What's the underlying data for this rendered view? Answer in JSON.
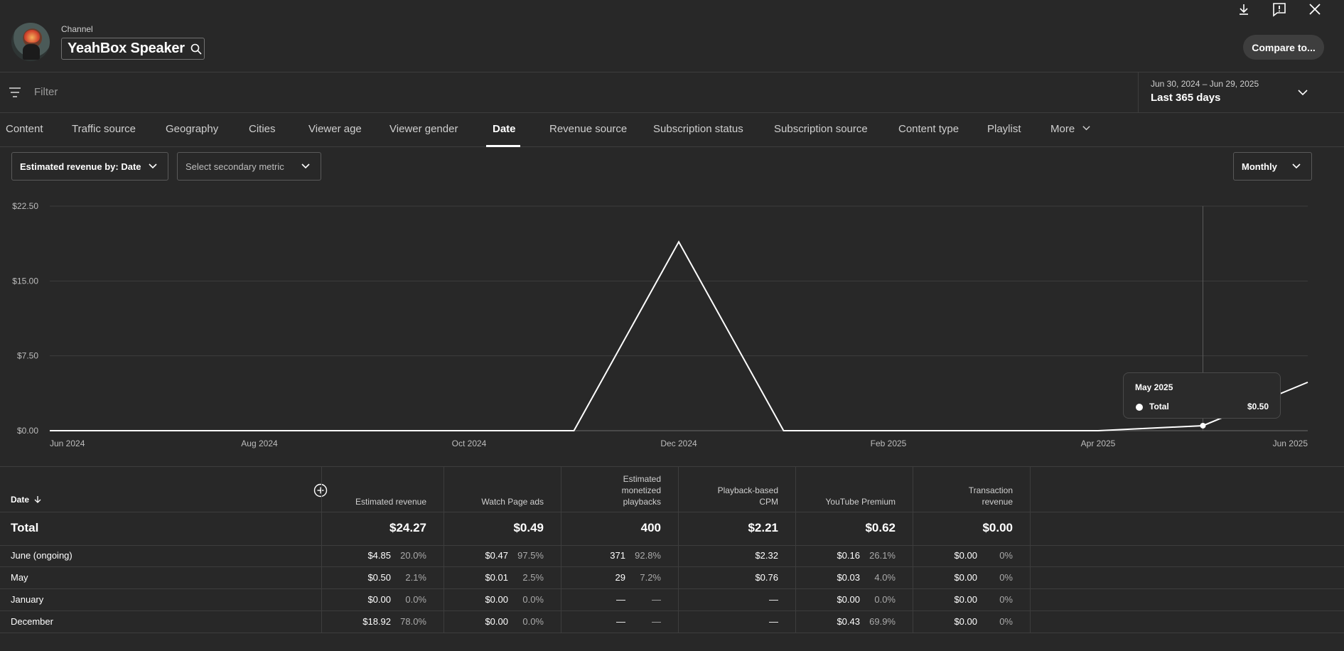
{
  "header": {
    "channel_label": "Channel",
    "channel_name": "YeahBox Speaker",
    "compare_label": "Compare to..."
  },
  "filterbar": {
    "placeholder": "Filter",
    "date_range_sub": "Jun 30, 2024 – Jun 29, 2025",
    "date_range_main": "Last 365 days"
  },
  "tabs": [
    {
      "label": "Content"
    },
    {
      "label": "Traffic source"
    },
    {
      "label": "Geography"
    },
    {
      "label": "Cities"
    },
    {
      "label": "Viewer age"
    },
    {
      "label": "Viewer gender"
    },
    {
      "label": "Date",
      "active": true
    },
    {
      "label": "Revenue source"
    },
    {
      "label": "Subscription status"
    },
    {
      "label": "Subscription source"
    },
    {
      "label": "Content type"
    },
    {
      "label": "Playlist"
    },
    {
      "label": "More"
    }
  ],
  "controls": {
    "primary_metric": "Estimated revenue by: Date",
    "secondary_metric": "Select secondary metric",
    "interval": "Monthly"
  },
  "chart_data": {
    "type": "line",
    "x_tick_labels": [
      "Jun 2024",
      "Aug 2024",
      "Oct 2024",
      "Dec 2024",
      "Feb 2025",
      "Apr 2025",
      "Jun 2025"
    ],
    "y_tick_labels": [
      "$22.50",
      "$15.00",
      "$7.50",
      "$0.00"
    ],
    "ylim": [
      0,
      22.5
    ],
    "series": [
      {
        "name": "Total",
        "x": [
          "2024-06",
          "2024-07",
          "2024-08",
          "2024-09",
          "2024-10",
          "2024-11",
          "2024-12",
          "2025-01",
          "2025-02",
          "2025-03",
          "2025-04",
          "2025-05",
          "2025-06"
        ],
        "values": [
          0,
          0,
          0,
          0,
          0,
          0,
          18.92,
          0,
          0,
          0,
          0,
          0.5,
          4.85
        ]
      }
    ],
    "hover": {
      "title": "May 2025",
      "series": "Total",
      "value": "$0.50"
    }
  },
  "table": {
    "date_header": "Date",
    "columns": [
      {
        "lines": [
          "Estimated revenue"
        ]
      },
      {
        "lines": [
          "Watch Page ads"
        ]
      },
      {
        "lines": [
          "Estimated",
          "monetized",
          "playbacks"
        ]
      },
      {
        "lines": [
          "Playback-based",
          "CPM"
        ]
      },
      {
        "lines": [
          "YouTube Premium"
        ]
      },
      {
        "lines": [
          "Transaction",
          "revenue"
        ]
      }
    ],
    "total": {
      "label": "Total",
      "values": [
        "$24.27",
        "$0.49",
        "400",
        "$2.21",
        "$0.62",
        "$0.00"
      ]
    },
    "rows": [
      {
        "label": "June (ongoing)",
        "cells": [
          [
            "$4.85",
            "20.0%"
          ],
          [
            "$0.47",
            "97.5%"
          ],
          [
            "371",
            "92.8%"
          ],
          [
            "$2.32",
            ""
          ],
          [
            "$0.16",
            "26.1%"
          ],
          [
            "$0.00",
            "0%"
          ]
        ]
      },
      {
        "label": "May",
        "cells": [
          [
            "$0.50",
            "2.1%"
          ],
          [
            "$0.01",
            "2.5%"
          ],
          [
            "29",
            "7.2%"
          ],
          [
            "$0.76",
            ""
          ],
          [
            "$0.03",
            "4.0%"
          ],
          [
            "$0.00",
            "0%"
          ]
        ]
      },
      {
        "label": "January",
        "cells": [
          [
            "$0.00",
            "0.0%"
          ],
          [
            "$0.00",
            "0.0%"
          ],
          [
            "—",
            "—"
          ],
          [
            "—",
            ""
          ],
          [
            "$0.00",
            "0.0%"
          ],
          [
            "$0.00",
            "0%"
          ]
        ]
      },
      {
        "label": "December",
        "cells": [
          [
            "$18.92",
            "78.0%"
          ],
          [
            "$0.00",
            "0.0%"
          ],
          [
            "—",
            "—"
          ],
          [
            "—",
            ""
          ],
          [
            "$0.43",
            "69.9%"
          ],
          [
            "$0.00",
            "0%"
          ]
        ]
      }
    ]
  }
}
